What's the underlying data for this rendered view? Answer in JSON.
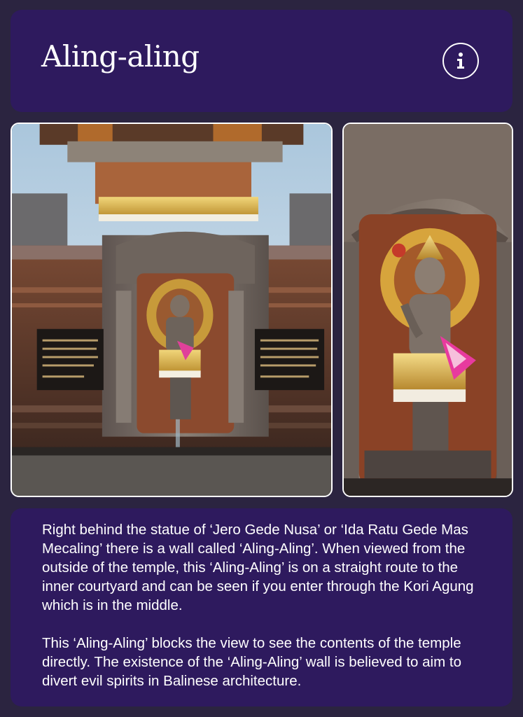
{
  "header": {
    "title": "Aling-aling",
    "info_icon": "info-icon"
  },
  "photos": [
    {
      "name": "temple-wall-photo"
    },
    {
      "name": "statue-closeup-photo"
    }
  ],
  "description": {
    "paragraphs": [
      "Right behind the statue of ‘Jero Gede Nusa’ or ‘Ida Ratu Gede Mas Mecaling’ there is a wall called ‘Aling-Aling’. When viewed from the outside of the temple, this ‘Aling-Aling’ is on a straight route to the inner courtyard and can be seen if you enter through the Kori Agung which is in the middle.",
      "This ‘Aling-Aling’ blocks the view to see the contents of the temple directly. The existence of the ‘Aling-Aling’ wall is believed to aim to divert evil spirits in Balinese architecture."
    ]
  },
  "colors": {
    "background": "#2b2440",
    "card": "#2e1a5e",
    "text": "#ffffff"
  }
}
